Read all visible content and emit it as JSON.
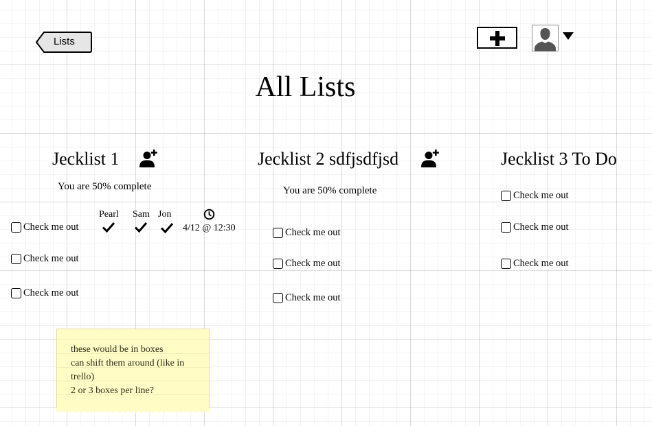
{
  "header": {
    "back_label": "Lists",
    "title": "All Lists"
  },
  "lists": [
    {
      "title": "Jecklist 1",
      "progress": "You are 50% complete",
      "people": [
        "Pearl",
        "Sam",
        "Jon"
      ],
      "timestamp": "4/12 @ 12:30",
      "items": [
        "Check me out",
        "Check me out",
        "Check me out"
      ]
    },
    {
      "title": "Jecklist 2 sdfjsdfjsd",
      "progress": "You are 50% complete",
      "items": [
        "Check me out",
        "Check me out",
        "Check me out"
      ]
    },
    {
      "title": "Jecklist 3 To Do",
      "items": [
        "Check me out",
        "Check me out",
        "Check me out"
      ]
    }
  ],
  "sticky_note": {
    "lines": [
      "these would be in boxes",
      "can shift them around (like in",
      "trello)",
      "2 or 3 boxes per line?"
    ]
  },
  "icons": {
    "back": "back-arrow-icon",
    "add": "plus-icon",
    "user": "avatar-icon",
    "add_user": "add-user-icon",
    "clock": "clock-icon",
    "check": "checkmark-icon"
  }
}
